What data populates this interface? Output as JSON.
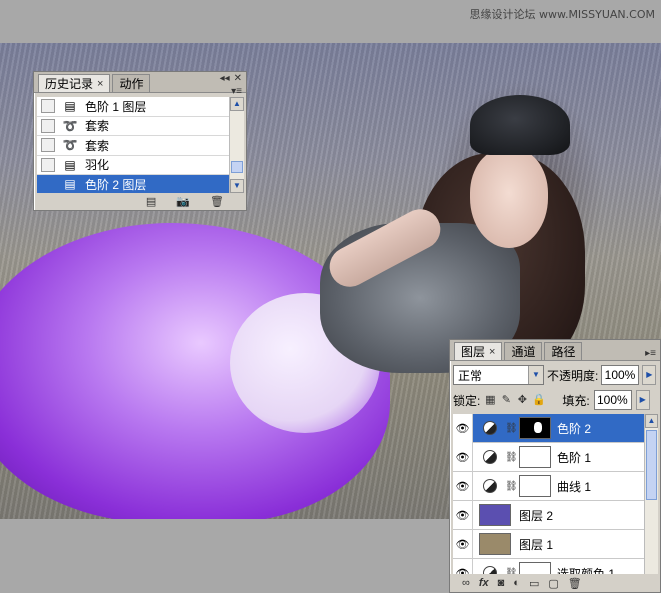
{
  "watermark": "思缘设计论坛 www.MISSYUAN.COM",
  "history_panel": {
    "tabs": [
      {
        "label": "历史记录",
        "close": "×"
      },
      {
        "label": "动作"
      }
    ],
    "ctrl_icons": [
      "close-icon",
      "panel-menu-icon"
    ],
    "items": [
      {
        "label": "色阶 1 图层",
        "icon": "adjustment-layer-icon",
        "selected": false
      },
      {
        "label": "套索",
        "icon": "lasso-icon",
        "selected": false
      },
      {
        "label": "套索",
        "icon": "lasso-icon",
        "selected": false
      },
      {
        "label": "羽化",
        "icon": "adjustment-layer-icon",
        "selected": false
      },
      {
        "label": "色阶 2 图层",
        "icon": "adjustment-layer-icon",
        "selected": true
      }
    ],
    "footer_icons": [
      "new-document-icon",
      "snapshot-icon",
      "trash-icon"
    ]
  },
  "layers_panel": {
    "tabs": [
      {
        "label": "图层",
        "close": "×"
      },
      {
        "label": "通道"
      },
      {
        "label": "路径"
      }
    ],
    "blend_mode": "正常",
    "opacity_label": "不透明度:",
    "opacity_value": "100%",
    "lock_label": "锁定:",
    "fill_label": "填充:",
    "fill_value": "100%",
    "layers": [
      {
        "name": "色阶 2",
        "type": "adjustment",
        "mask": "dark",
        "selected": true
      },
      {
        "name": "色阶 1",
        "type": "adjustment",
        "mask": "white",
        "selected": false
      },
      {
        "name": "曲线 1",
        "type": "adjustment",
        "mask": "white",
        "selected": false
      },
      {
        "name": "图层 2",
        "type": "pixel",
        "thumb_color": "#5b4fb0",
        "selected": false
      },
      {
        "name": "图层 1",
        "type": "pixel",
        "thumb_color": "#9a8a6a",
        "selected": false
      },
      {
        "name": "选取颜色 1",
        "type": "adjustment",
        "mask": "white",
        "selected": false
      }
    ],
    "footer_icons": [
      "link-icon",
      "fx-icon",
      "mask-icon",
      "adjustment-icon",
      "folder-icon",
      "new-layer-icon",
      "trash-icon"
    ],
    "footer_fx": "fx"
  },
  "colors": {
    "selection": "#316ac5"
  }
}
